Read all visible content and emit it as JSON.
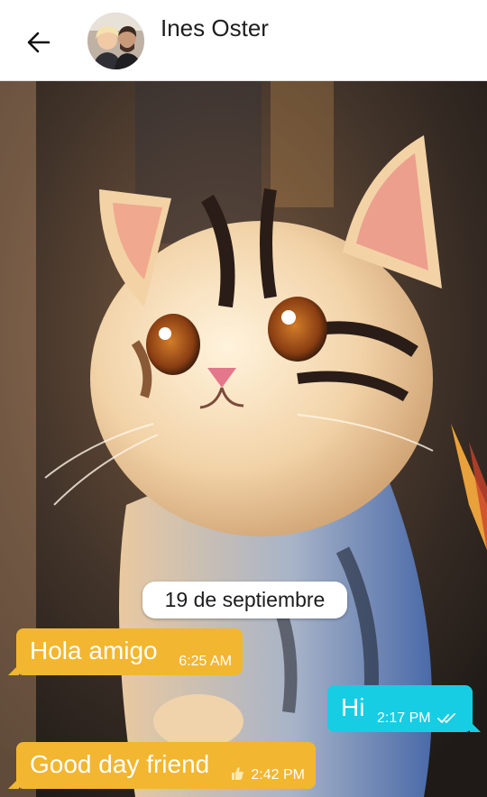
{
  "header": {
    "contact_name": "Ines Oster",
    "back_icon": "arrow-left-icon",
    "avatar_icon": "contact-avatar"
  },
  "chat": {
    "wallpaper": "kitten-wallpaper",
    "date_separator": "19 de septiembre",
    "messages": [
      {
        "direction": "incoming",
        "text": "Hola amigo",
        "time": "6:25 AM"
      },
      {
        "direction": "outgoing",
        "text": "Hi",
        "time": "2:17 PM",
        "status_icon": "double-check-icon"
      },
      {
        "direction": "incoming",
        "text": "Good day friend",
        "time": "2:42 PM",
        "reaction_icon": "thumbs-up-icon"
      }
    ]
  },
  "colors": {
    "incoming_bubble": "#f2b630",
    "outgoing_bubble": "#17cde3",
    "header_bg": "#ffffff"
  }
}
